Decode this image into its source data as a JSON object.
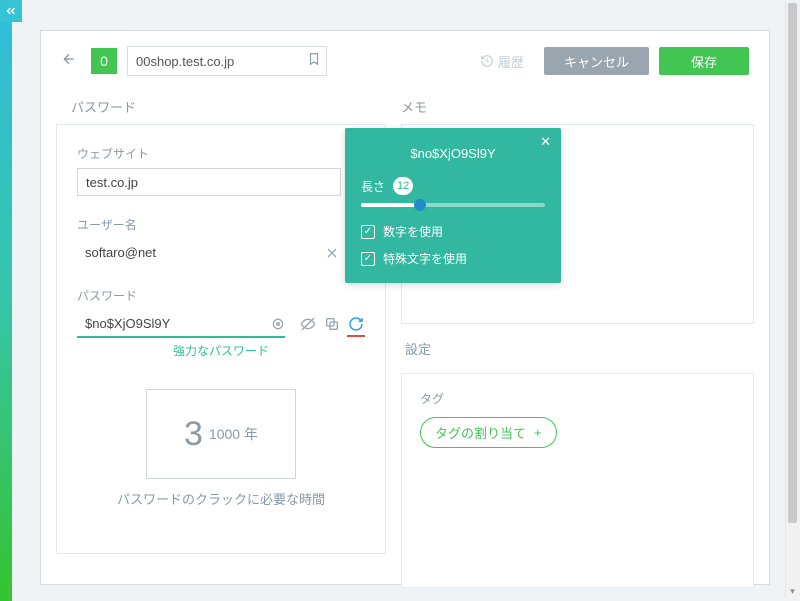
{
  "topbar": {
    "rank": "0",
    "title": "00shop.test.co.jp",
    "history_label": "履歴",
    "cancel_label": "キャンセル",
    "save_label": "保存"
  },
  "sections": {
    "password": "パスワード",
    "memo": "メモ",
    "settings": "設定"
  },
  "fields": {
    "website_label": "ウェブサイト",
    "website_value": "test.co.jp",
    "username_label": "ユーザー名",
    "username_value": "softaro@net",
    "password_label": "パスワード",
    "password_value": "$no$XjO9Sl9Y",
    "strength_label": "強力なパスワード"
  },
  "crack": {
    "big": "3",
    "unit": "1000",
    "suffix": "年",
    "caption": "パスワードのクラックに必要な時間"
  },
  "settings_panel": {
    "tag_label": "タグ",
    "assign_tag": "タグの割り当て",
    "plus": "+"
  },
  "popover": {
    "sample": "$no$XjO9Sl9Y",
    "length_label": "長さ",
    "length_value": "12",
    "use_numbers": "数字を使用",
    "use_symbols": "特殊文字を使用",
    "slider_percent": 32
  },
  "colors": {
    "teal": "#32b7a0",
    "green": "#42c553",
    "accent_blue": "#2aa0e5"
  }
}
